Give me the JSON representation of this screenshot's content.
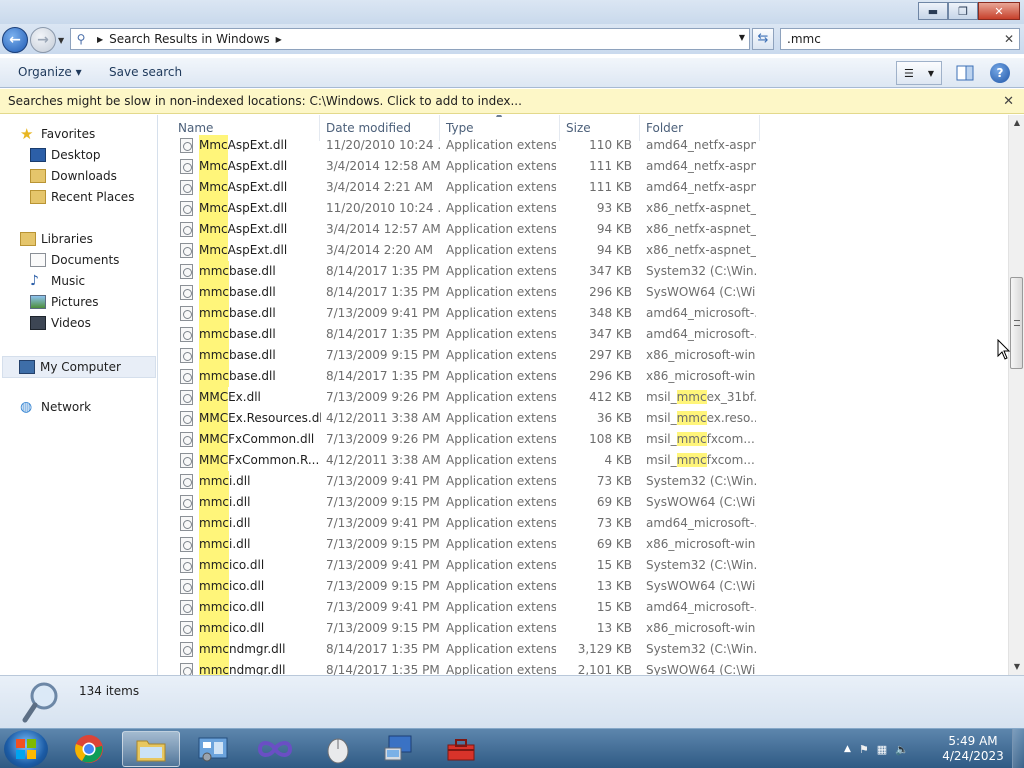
{
  "window": {
    "minimize": "▬",
    "maximize": "❐",
    "close": "✕"
  },
  "address": {
    "path": "Search Results in Windows",
    "search_value": ".mmc",
    "clear": "✕"
  },
  "toolbar": {
    "organize_label": "Organize ▾",
    "save_search_label": "Save search",
    "help": "?"
  },
  "infobar": {
    "message": "Searches might be slow in non-indexed locations: C:\\Windows. Click to add to index...",
    "close": "✕"
  },
  "nav": {
    "favorites": "Favorites",
    "desktop": "Desktop",
    "downloads": "Downloads",
    "recent_places": "Recent Places",
    "libraries": "Libraries",
    "documents": "Documents",
    "music": "Music",
    "pictures": "Pictures",
    "videos": "Videos",
    "my_computer": "My Computer",
    "network": "Network"
  },
  "columns": {
    "name": "Name",
    "date": "Date modified",
    "type": "Type",
    "size": "Size",
    "folder": "Folder"
  },
  "files": [
    {
      "hl": "Mmc",
      "rest": "AspExt.dll",
      "date": "11/20/2010 10:24 ...",
      "type": "Application extens...",
      "size": "110 KB",
      "folder_hl": "",
      "folder": "amd64_netfx-aspn...",
      "folder_rest": ""
    },
    {
      "hl": "Mmc",
      "rest": "AspExt.dll",
      "date": "3/4/2014 12:58 AM",
      "type": "Application extens...",
      "size": "111 KB",
      "folder_hl": "",
      "folder": "amd64_netfx-aspn...",
      "folder_rest": ""
    },
    {
      "hl": "Mmc",
      "rest": "AspExt.dll",
      "date": "3/4/2014 2:21 AM",
      "type": "Application extens...",
      "size": "111 KB",
      "folder_hl": "",
      "folder": "amd64_netfx-aspn...",
      "folder_rest": ""
    },
    {
      "hl": "Mmc",
      "rest": "AspExt.dll",
      "date": "11/20/2010 10:24 ...",
      "type": "Application extens...",
      "size": "93 KB",
      "folder_hl": "",
      "folder": "x86_netfx-aspnet_...",
      "folder_rest": ""
    },
    {
      "hl": "Mmc",
      "rest": "AspExt.dll",
      "date": "3/4/2014 12:57 AM",
      "type": "Application extens...",
      "size": "94 KB",
      "folder_hl": "",
      "folder": "x86_netfx-aspnet_...",
      "folder_rest": ""
    },
    {
      "hl": "Mmc",
      "rest": "AspExt.dll",
      "date": "3/4/2014 2:20 AM",
      "type": "Application extens...",
      "size": "94 KB",
      "folder_hl": "",
      "folder": "x86_netfx-aspnet_...",
      "folder_rest": ""
    },
    {
      "hl": "mmc",
      "rest": "base.dll",
      "date": "8/14/2017 1:35 PM",
      "type": "Application extens...",
      "size": "347 KB",
      "folder_hl": "",
      "folder": "System32 (C:\\Win...",
      "folder_rest": ""
    },
    {
      "hl": "mmc",
      "rest": "base.dll",
      "date": "8/14/2017 1:35 PM",
      "type": "Application extens...",
      "size": "296 KB",
      "folder_hl": "",
      "folder": "SysWOW64 (C:\\Wi...",
      "folder_rest": ""
    },
    {
      "hl": "mmc",
      "rest": "base.dll",
      "date": "7/13/2009 9:41 PM",
      "type": "Application extens...",
      "size": "348 KB",
      "folder_hl": "",
      "folder": "amd64_microsoft-...",
      "folder_rest": ""
    },
    {
      "hl": "mmc",
      "rest": "base.dll",
      "date": "8/14/2017 1:35 PM",
      "type": "Application extens...",
      "size": "347 KB",
      "folder_hl": "",
      "folder": "amd64_microsoft-...",
      "folder_rest": ""
    },
    {
      "hl": "mmc",
      "rest": "base.dll",
      "date": "7/13/2009 9:15 PM",
      "type": "Application extens...",
      "size": "297 KB",
      "folder_hl": "",
      "folder": "x86_microsoft-win...",
      "folder_rest": ""
    },
    {
      "hl": "mmc",
      "rest": "base.dll",
      "date": "8/14/2017 1:35 PM",
      "type": "Application extens...",
      "size": "296 KB",
      "folder_hl": "",
      "folder": "x86_microsoft-win...",
      "folder_rest": ""
    },
    {
      "hl": "MMC",
      "rest": "Ex.dll",
      "date": "7/13/2009 9:26 PM",
      "type": "Application extens...",
      "size": "412 KB",
      "folder_hl": "mmc",
      "folder": "msil_",
      "folder_rest": "ex_31bf..."
    },
    {
      "hl": "MMC",
      "rest": "Ex.Resources.dll",
      "date": "4/12/2011 3:38 AM",
      "type": "Application extens...",
      "size": "36 KB",
      "folder_hl": "mmc",
      "folder": "msil_",
      "folder_rest": "ex.reso..."
    },
    {
      "hl": "MMC",
      "rest": "FxCommon.dll",
      "date": "7/13/2009 9:26 PM",
      "type": "Application extens...",
      "size": "108 KB",
      "folder_hl": "mmc",
      "folder": "msil_",
      "folder_rest": "fxcom..."
    },
    {
      "hl": "MMC",
      "rest": "FxCommon.R...",
      "date": "4/12/2011 3:38 AM",
      "type": "Application extens...",
      "size": "4 KB",
      "folder_hl": "mmc",
      "folder": "msil_",
      "folder_rest": "fxcom..."
    },
    {
      "hl": "mmc",
      "rest": "i.dll",
      "date": "7/13/2009 9:41 PM",
      "type": "Application extens...",
      "size": "73 KB",
      "folder_hl": "",
      "folder": "System32 (C:\\Win...",
      "folder_rest": ""
    },
    {
      "hl": "mmc",
      "rest": "i.dll",
      "date": "7/13/2009 9:15 PM",
      "type": "Application extens...",
      "size": "69 KB",
      "folder_hl": "",
      "folder": "SysWOW64 (C:\\Wi...",
      "folder_rest": ""
    },
    {
      "hl": "mmc",
      "rest": "i.dll",
      "date": "7/13/2009 9:41 PM",
      "type": "Application extens...",
      "size": "73 KB",
      "folder_hl": "",
      "folder": "amd64_microsoft-...",
      "folder_rest": ""
    },
    {
      "hl": "mmc",
      "rest": "i.dll",
      "date": "7/13/2009 9:15 PM",
      "type": "Application extens...",
      "size": "69 KB",
      "folder_hl": "",
      "folder": "x86_microsoft-win...",
      "folder_rest": ""
    },
    {
      "hl": "mmc",
      "rest": "ico.dll",
      "date": "7/13/2009 9:41 PM",
      "type": "Application extens...",
      "size": "15 KB",
      "folder_hl": "",
      "folder": "System32 (C:\\Win...",
      "folder_rest": ""
    },
    {
      "hl": "mmc",
      "rest": "ico.dll",
      "date": "7/13/2009 9:15 PM",
      "type": "Application extens...",
      "size": "13 KB",
      "folder_hl": "",
      "folder": "SysWOW64 (C:\\Wi...",
      "folder_rest": ""
    },
    {
      "hl": "mmc",
      "rest": "ico.dll",
      "date": "7/13/2009 9:41 PM",
      "type": "Application extens...",
      "size": "15 KB",
      "folder_hl": "",
      "folder": "amd64_microsoft-...",
      "folder_rest": ""
    },
    {
      "hl": "mmc",
      "rest": "ico.dll",
      "date": "7/13/2009 9:15 PM",
      "type": "Application extens...",
      "size": "13 KB",
      "folder_hl": "",
      "folder": "x86_microsoft-win...",
      "folder_rest": ""
    },
    {
      "hl": "mmc",
      "rest": "ndmgr.dll",
      "date": "8/14/2017 1:35 PM",
      "type": "Application extens...",
      "size": "3,129 KB",
      "folder_hl": "",
      "folder": "System32 (C:\\Win...",
      "folder_rest": ""
    },
    {
      "hl": "mmc",
      "rest": "ndmgr.dll",
      "date": "8/14/2017 1:35 PM",
      "type": "Application extens...",
      "size": "2,101 KB",
      "folder_hl": "",
      "folder": "SysWOW64 (C:\\Wi...",
      "folder_rest": ""
    }
  ],
  "status": {
    "item_count": "134 items"
  },
  "taskbar": {
    "time": "5:49 AM",
    "date": "4/24/2023"
  },
  "colors": {
    "highlight": "#fff57a",
    "accent": "#1f5ab3",
    "infobar": "#fdf7c7"
  }
}
